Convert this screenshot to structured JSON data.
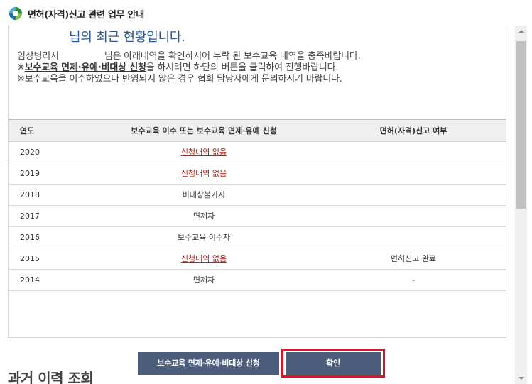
{
  "window": {
    "title": "면허(자격)신고 관련 업무 안내",
    "icon": "app-logo-icon"
  },
  "status": {
    "heading": "님의 최근 현황입니다.",
    "line1_prefix": "임상병리시",
    "line1_suffix": "님은 아래내역을 확인하시어 누락 된 보수교육 내역을 충족바랍니다.",
    "line2_mark": "※",
    "line2_emph": "보수교육 면제·유예·비대상 신청",
    "line2_rest": "을 하시려면 하단의 버튼을 클릭하여 진행바랍니다.",
    "line3": "※보수교육을 이수하였으나 반영되지 않은 경우 협회 담당자에게 문의하시기 바랍니다."
  },
  "table": {
    "headers": [
      "연도",
      "보수교육 이수 또는 보수교육 면제·유예 신청",
      "면허(자격)신고 여부"
    ],
    "rows": [
      {
        "year": "2020",
        "education": "신청내역 없음",
        "education_link": true,
        "report": ""
      },
      {
        "year": "2019",
        "education": "신청내역 없음",
        "education_link": true,
        "report": ""
      },
      {
        "year": "2018",
        "education": "비대상불가자",
        "education_link": false,
        "report": ""
      },
      {
        "year": "2017",
        "education": "면제자",
        "education_link": false,
        "report": ""
      },
      {
        "year": "2016",
        "education": "보수교육 이수자",
        "education_link": false,
        "report": ""
      },
      {
        "year": "2015",
        "education": "신청내역 없음",
        "education_link": true,
        "report": "면허신고 완료"
      },
      {
        "year": "2014",
        "education": "면제자",
        "education_link": false,
        "report": "-"
      }
    ]
  },
  "buttons": {
    "apply": "보수교육 면제·유예·비대상 신청",
    "confirm": "확인"
  },
  "section": {
    "past_history": "과거 이력 조회"
  },
  "colors": {
    "accent": "#2a5a96",
    "button": "#4d5d7c",
    "link": "#b3261e",
    "highlight_border": "#e5131d"
  }
}
